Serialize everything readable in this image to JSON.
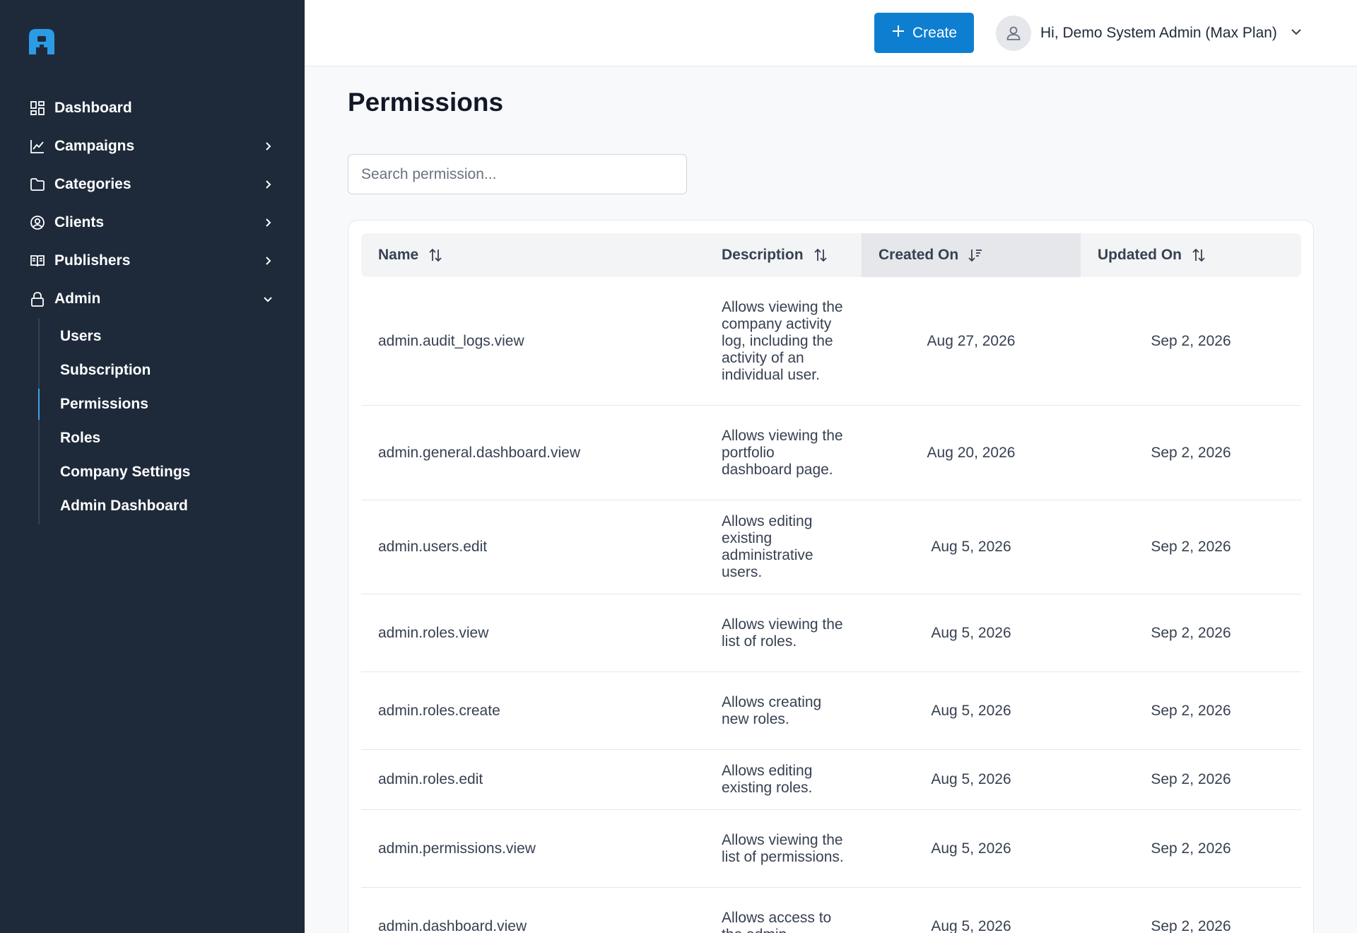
{
  "sidebar": {
    "items": [
      {
        "label": "Dashboard",
        "icon": "dashboard-icon"
      },
      {
        "label": "Campaigns",
        "icon": "chart-line-icon"
      },
      {
        "label": "Categories",
        "icon": "folder-icon"
      },
      {
        "label": "Clients",
        "icon": "user-circle-icon"
      },
      {
        "label": "Publishers",
        "icon": "book-open-icon"
      },
      {
        "label": "Admin",
        "icon": "lock-icon"
      }
    ],
    "admin_subitems": [
      "Users",
      "Subscription",
      "Permissions",
      "Roles",
      "Company Settings",
      "Admin Dashboard"
    ],
    "active_subitem": "Permissions"
  },
  "header": {
    "create_label": "Create",
    "user_greeting": "Hi, Demo System Admin (Max Plan)"
  },
  "page": {
    "title": "Permissions",
    "search_placeholder": "Search permission..."
  },
  "table": {
    "columns": [
      "Name",
      "Description",
      "Created On",
      "Updated On"
    ],
    "sorted_column": "Created On",
    "rows": [
      {
        "name": "admin.audit_logs.view",
        "description": "Allows viewing the company activity log, including the activity of an individual user.",
        "created": "Aug 27, 2026",
        "updated": "Sep 2, 2026"
      },
      {
        "name": "admin.general.dashboard.view",
        "description": "Allows viewing the portfolio dashboard page.",
        "created": "Aug 20, 2026",
        "updated": "Sep 2, 2026"
      },
      {
        "name": "admin.users.edit",
        "description": "Allows editing existing administrative users.",
        "created": "Aug 5, 2026",
        "updated": "Sep 2, 2026"
      },
      {
        "name": "admin.roles.view",
        "description": "Allows viewing the list of roles.",
        "created": "Aug 5, 2026",
        "updated": "Sep 2, 2026"
      },
      {
        "name": "admin.roles.create",
        "description": "Allows creating new roles.",
        "created": "Aug 5, 2026",
        "updated": "Sep 2, 2026"
      },
      {
        "name": "admin.roles.edit",
        "description": "Allows editing existing roles.",
        "created": "Aug 5, 2026",
        "updated": "Sep 2, 2026"
      },
      {
        "name": "admin.permissions.view",
        "description": "Allows viewing the list of permissions.",
        "created": "Aug 5, 2026",
        "updated": "Sep 2, 2026"
      },
      {
        "name": "admin.dashboard.view",
        "description": "Allows access to the admin",
        "created": "Aug 5, 2026",
        "updated": "Sep 2, 2026"
      }
    ]
  },
  "colors": {
    "sidebar_bg": "#1e2a3a",
    "accent": "#0e7fd0",
    "logo": "#38a3e8"
  }
}
